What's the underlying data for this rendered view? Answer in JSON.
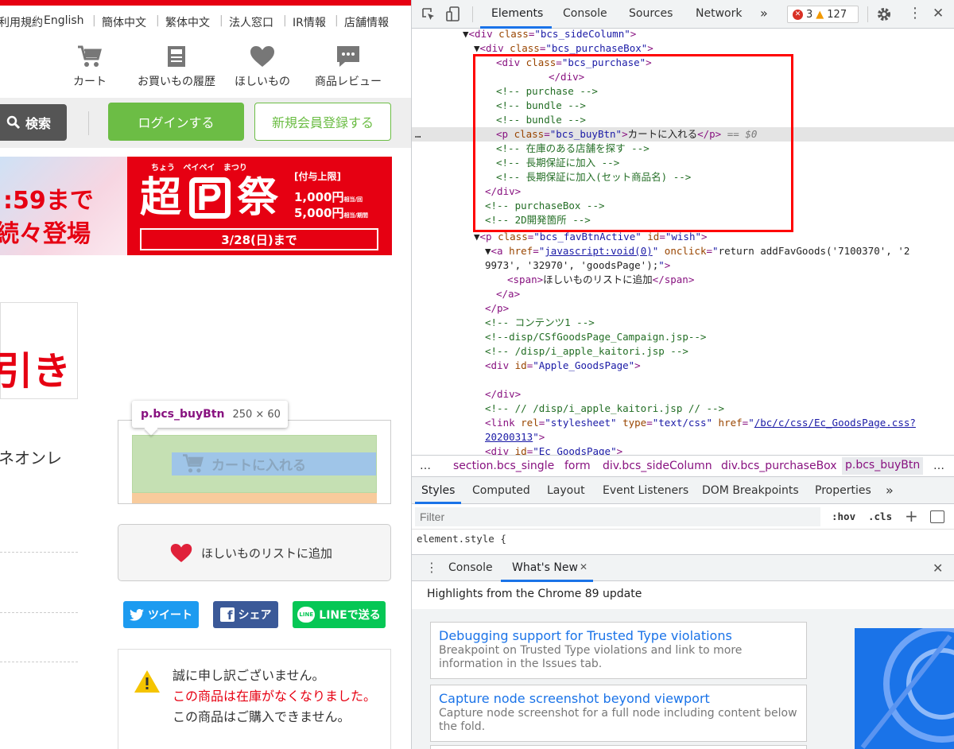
{
  "site": {
    "nav_links": [
      "利用規約",
      "English",
      "簡体中文",
      "繁体中文",
      "法人窓口",
      "IR情報",
      "店舗情報"
    ],
    "icons": [
      {
        "label": "カート",
        "icon": "cart-icon"
      },
      {
        "label": "お買いもの履歴",
        "icon": "history-icon"
      },
      {
        "label": "ほしいもの",
        "icon": "heart-icon"
      },
      {
        "label": "商品レビュー",
        "icon": "review-icon"
      }
    ],
    "search_label": "検索",
    "login_label": "ログインする",
    "register_label": "新規会員登録する",
    "banner_left": {
      "time": ":59まで",
      "sub": "続々登場"
    },
    "banner_right": {
      "ruby": "ちょう   ペイペイ   まつり",
      "title": "超",
      "title2": "祭",
      "cap_label": "[付与上限]",
      "amount1": "1,000円",
      "amount1_note": "相当/回",
      "amount2": "5,000円",
      "amount2_note": "相当/期間",
      "until": "3/28(日)まで"
    },
    "big_text": "引き",
    "product_text": "ネオンレ",
    "tooltip": {
      "selector": "p.bcs_buyBtn",
      "size": "250 × 60"
    },
    "cart_button": "カートに入れる",
    "wish_button": "ほしいものリストに追加",
    "share": [
      {
        "label": "ツイート",
        "color": "#1d9bf0"
      },
      {
        "label": "シェア",
        "color": "#3b5998"
      },
      {
        "label": "LINEで送る",
        "color": "#06c755"
      }
    ],
    "warning": {
      "line1": "誠に申し訳ございません。",
      "line2": "この商品は在庫がなくなりました。",
      "line3": "この商品はご購入できません。"
    }
  },
  "devtools": {
    "tabs": [
      "Elements",
      "Console",
      "Sources",
      "Network"
    ],
    "more": "»",
    "errors": "3",
    "warnings": "127",
    "breadcrumbs": [
      "section.bcs_single",
      "form",
      "div.bcs_sideColumn",
      "div.bcs_purchaseBox",
      "p.bcs_buyBtn"
    ],
    "style_tabs": [
      "Styles",
      "Computed",
      "Layout",
      "Event Listeners",
      "DOM Breakpoints",
      "Properties"
    ],
    "filter_placeholder": "Filter",
    "hov": ":hov",
    "cls": ".cls",
    "element_style": "element.style {",
    "drawer_tabs": [
      "Console",
      "What's New"
    ],
    "whats_new_title": "Highlights from the Chrome 89 update",
    "cards": [
      {
        "title": "Debugging support for Trusted Type violations",
        "desc": "Breakpoint on Trusted Type violations and link to more information in the Issues tab."
      },
      {
        "title": "Capture node screenshot beyond viewport",
        "desc": "Capture node screenshot for a full node including content below the fold."
      }
    ]
  },
  "colors": {
    "brand_red": "#e60012",
    "login_green": "#6cbd45",
    "highlight_red": "#ff0000"
  }
}
